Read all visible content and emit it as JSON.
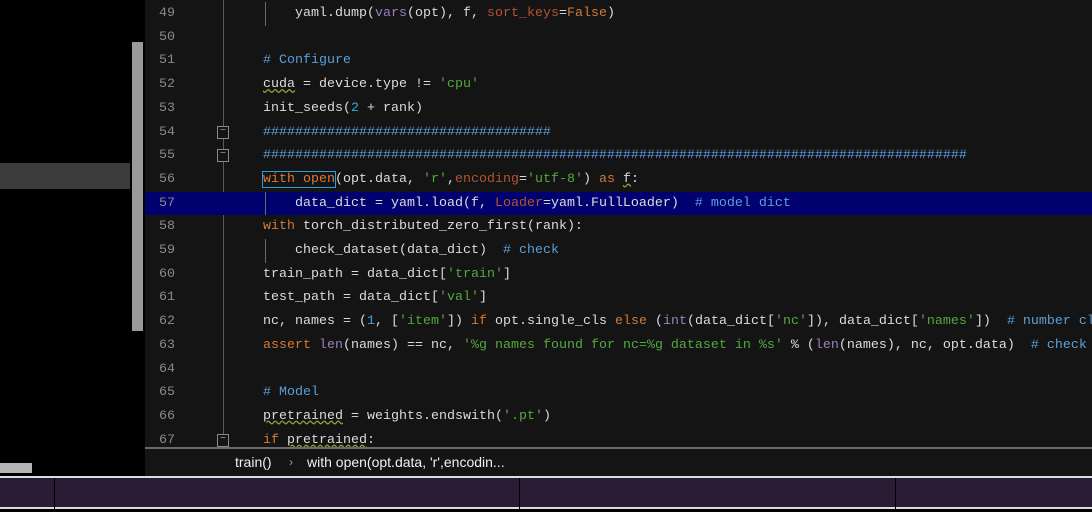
{
  "editor": {
    "current_line": 57,
    "lines": [
      {
        "n": "49",
        "guide": true,
        "tokens": [
          [
            "    yaml.dump(",
            ""
          ],
          [
            "vars",
            "bi"
          ],
          [
            "(opt), f, ",
            ""
          ],
          [
            "sort_keys",
            "par"
          ],
          [
            "=",
            ""
          ],
          [
            "False",
            "kw"
          ],
          [
            ")",
            ""
          ]
        ]
      },
      {
        "n": "50",
        "tokens": []
      },
      {
        "n": "51",
        "tokens": [
          [
            "# Configure",
            "com"
          ]
        ]
      },
      {
        "n": "52",
        "tokens": [
          [
            "cuda",
            "squig"
          ],
          [
            " = device.type != ",
            ""
          ],
          [
            "'cpu'",
            "str"
          ]
        ]
      },
      {
        "n": "53",
        "tokens": [
          [
            "init_seeds(",
            ""
          ],
          [
            "2",
            "num"
          ],
          [
            " + rank)",
            ""
          ]
        ]
      },
      {
        "n": "54",
        "fold": true,
        "tokens": [
          [
            "####################################",
            "com"
          ]
        ]
      },
      {
        "n": "55",
        "fold": true,
        "tokens": [
          [
            "########################################################################################",
            "com"
          ]
        ]
      },
      {
        "n": "56",
        "tokens": [
          [
            "with open",
            "kw box"
          ],
          [
            "(opt.data, ",
            ""
          ],
          [
            "'r'",
            "str"
          ],
          [
            ",",
            ""
          ],
          [
            "encoding",
            "par"
          ],
          [
            "=",
            ""
          ],
          [
            "'utf-8'",
            "str"
          ],
          [
            ") ",
            ""
          ],
          [
            "as",
            "kw"
          ],
          [
            " ",
            ""
          ],
          [
            "f",
            "squig"
          ],
          [
            ":",
            ""
          ]
        ]
      },
      {
        "n": "57",
        "guide": true,
        "tokens": [
          [
            "    data_dict = yaml.load(f, ",
            ""
          ],
          [
            "Loader",
            "par"
          ],
          [
            "=yaml.FullLoader)  ",
            ""
          ],
          [
            "# model dict",
            "com"
          ]
        ]
      },
      {
        "n": "58",
        "tokens": [
          [
            "with",
            "kw"
          ],
          [
            " torch_distributed_zero_first(rank):",
            ""
          ]
        ]
      },
      {
        "n": "59",
        "guide": true,
        "tokens": [
          [
            "    check_dataset(data_dict)  ",
            ""
          ],
          [
            "# check",
            "com"
          ]
        ]
      },
      {
        "n": "60",
        "tokens": [
          [
            "train_path = data_dict[",
            ""
          ],
          [
            "'train'",
            "str"
          ],
          [
            "]",
            ""
          ]
        ]
      },
      {
        "n": "61",
        "tokens": [
          [
            "test_path = data_dict[",
            ""
          ],
          [
            "'val'",
            "str"
          ],
          [
            "]",
            ""
          ]
        ]
      },
      {
        "n": "62",
        "tokens": [
          [
            "nc, names = (",
            ""
          ],
          [
            "1",
            "num"
          ],
          [
            ", [",
            ""
          ],
          [
            "'item'",
            "str"
          ],
          [
            "]) ",
            ""
          ],
          [
            "if",
            "kw"
          ],
          [
            " opt.single_cls ",
            ""
          ],
          [
            "else",
            "kw"
          ],
          [
            " (",
            ""
          ],
          [
            "int",
            "bi"
          ],
          [
            "(data_dict[",
            ""
          ],
          [
            "'nc'",
            "str"
          ],
          [
            "]), data_dict[",
            ""
          ],
          [
            "'names'",
            "str"
          ],
          [
            "])  ",
            ""
          ],
          [
            "# number classes",
            "com"
          ]
        ]
      },
      {
        "n": "63",
        "tokens": [
          [
            "assert",
            "kw"
          ],
          [
            " ",
            ""
          ],
          [
            "len",
            "bi"
          ],
          [
            "(names) == nc, ",
            ""
          ],
          [
            "'%g names found for nc=%g dataset in %s'",
            "str"
          ],
          [
            " % (",
            ""
          ],
          [
            "len",
            "bi"
          ],
          [
            "(names), nc, opt.data)  ",
            ""
          ],
          [
            "# check",
            "com"
          ]
        ]
      },
      {
        "n": "64",
        "tokens": []
      },
      {
        "n": "65",
        "tokens": [
          [
            "# Model",
            "com"
          ]
        ]
      },
      {
        "n": "66",
        "tokens": [
          [
            "pretrained",
            "squig"
          ],
          [
            " = weights.endswith(",
            ""
          ],
          [
            "'.pt'",
            "str"
          ],
          [
            ")",
            ""
          ]
        ]
      },
      {
        "n": "67",
        "fold": true,
        "tokens": [
          [
            "if",
            "kw"
          ],
          [
            " ",
            ""
          ],
          [
            "pretrained",
            "squig"
          ],
          [
            ":",
            ""
          ]
        ]
      }
    ]
  },
  "breadcrumb": {
    "function": "train()",
    "separator": "›",
    "block": "with open(opt.data, 'r',encodin..."
  },
  "colors": {
    "keyword": "#d57a33",
    "string": "#53a83c",
    "comment": "#5b9fd8",
    "current_line": "#00006e",
    "band": "#2a1c35"
  }
}
